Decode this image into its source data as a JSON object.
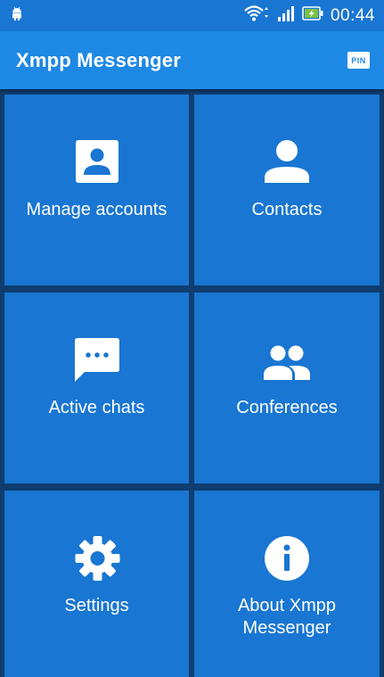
{
  "status_bar": {
    "time": "00:44",
    "icons": [
      "android-icon",
      "wifi-icon",
      "signal-icon",
      "battery-charging-icon"
    ]
  },
  "app_bar": {
    "title": "Xmpp Messenger",
    "pin_label": "PIN"
  },
  "tiles": [
    {
      "label": "Manage accounts",
      "icon": "account-box-icon"
    },
    {
      "label": "Contacts",
      "icon": "person-icon"
    },
    {
      "label": "Active chats",
      "icon": "chat-icon"
    },
    {
      "label": "Conferences",
      "icon": "group-icon"
    },
    {
      "label": "Settings",
      "icon": "gear-icon"
    },
    {
      "label": "About Xmpp Messenger",
      "icon": "info-icon"
    }
  ],
  "colors": {
    "status_bar": "#1976d2",
    "app_bar": "#1e88e5",
    "tile": "#1976d2",
    "grid_background": "#0f3d6f",
    "battery_green": "#7cc043"
  }
}
